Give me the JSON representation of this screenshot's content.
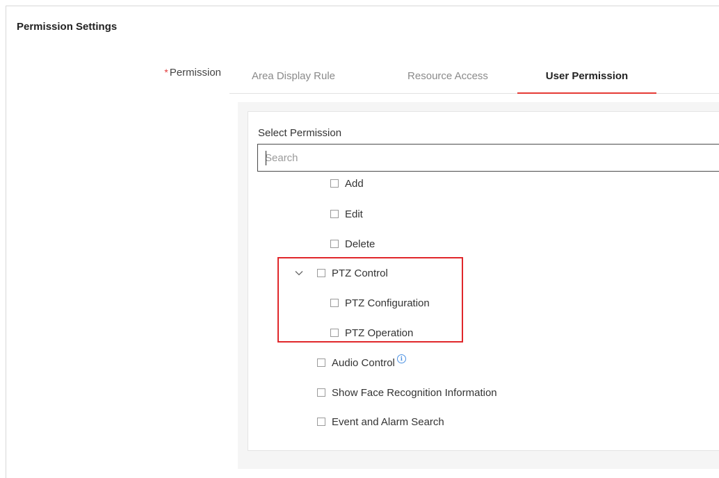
{
  "section": {
    "title": "Permission Settings"
  },
  "field": {
    "required_mark": "*",
    "label": "Permission"
  },
  "tabs": [
    {
      "label": "Area Display Rule",
      "active": false
    },
    {
      "label": "Resource Access",
      "active": false
    },
    {
      "label": "User Permission",
      "active": true
    }
  ],
  "permissions": {
    "select_label": "Select Permission",
    "search_placeholder": "Search",
    "items": [
      {
        "label": "Add",
        "checked": false
      },
      {
        "label": "Edit",
        "checked": false
      },
      {
        "label": "Delete",
        "checked": false
      },
      {
        "label": "PTZ Control",
        "checked": false,
        "expanded": true
      },
      {
        "label": "PTZ Configuration",
        "checked": false
      },
      {
        "label": "PTZ Operation",
        "checked": false
      },
      {
        "label": "Audio Control",
        "checked": false,
        "info_icon": "info-icon"
      },
      {
        "label": "Show Face Recognition Information",
        "checked": false
      },
      {
        "label": "Event and Alarm Search",
        "checked": false
      }
    ]
  },
  "colors": {
    "accent": "#e53935",
    "highlight": "#e0262a",
    "info": "#4a90e2"
  }
}
